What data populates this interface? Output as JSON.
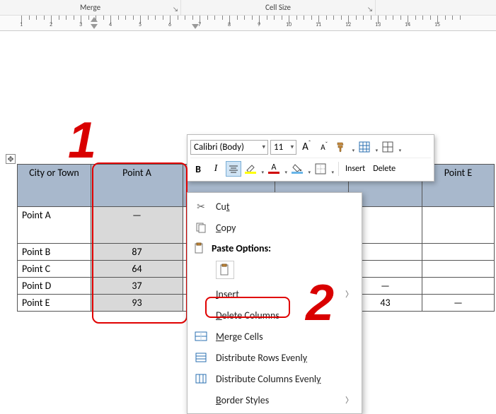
{
  "ribbon": {
    "group_merge": "Merge",
    "group_cellsize": "Cell Size"
  },
  "ruler": {
    "numbers": [
      1,
      2,
      3,
      4,
      5,
      6,
      7,
      8,
      9,
      10,
      11,
      12,
      13,
      14,
      15
    ]
  },
  "table": {
    "headers": [
      "City or Town",
      "Point A",
      "",
      "",
      "",
      "Point E"
    ],
    "rows": [
      {
        "label": "Point A",
        "cells": [
          "—",
          "",
          "",
          "",
          ""
        ]
      },
      {
        "label": "Point B",
        "cells": [
          "87",
          "",
          "",
          "",
          ""
        ]
      },
      {
        "label": "Point C",
        "cells": [
          "64",
          "",
          "",
          "",
          ""
        ]
      },
      {
        "label": "Point D",
        "cells": [
          "37",
          "",
          "",
          "—",
          ""
        ]
      },
      {
        "label": "Point E",
        "cells": [
          "93",
          "",
          "",
          "43",
          "—"
        ]
      }
    ]
  },
  "mini_toolbar": {
    "font_name": "Calibri (Body)",
    "font_size": "11",
    "grow_font": "A",
    "shrink_font": "A",
    "bold": "B",
    "italic": "I",
    "highlight_letter": "A",
    "fontcolor_letter": "A",
    "insert_label": "Insert",
    "delete_label": "Delete"
  },
  "context_menu": {
    "cut": "Cut",
    "copy": "Copy",
    "paste_options": "Paste Options:",
    "insert": "Insert",
    "delete_columns": "Delete Columns",
    "merge_cells": "Merge Cells",
    "dist_rows": "Distribute Rows Evenly",
    "dist_cols": "Distribute Columns Evenly",
    "border_styles": "Border Styles"
  },
  "annotations": {
    "num1": "1",
    "num2": "2"
  }
}
